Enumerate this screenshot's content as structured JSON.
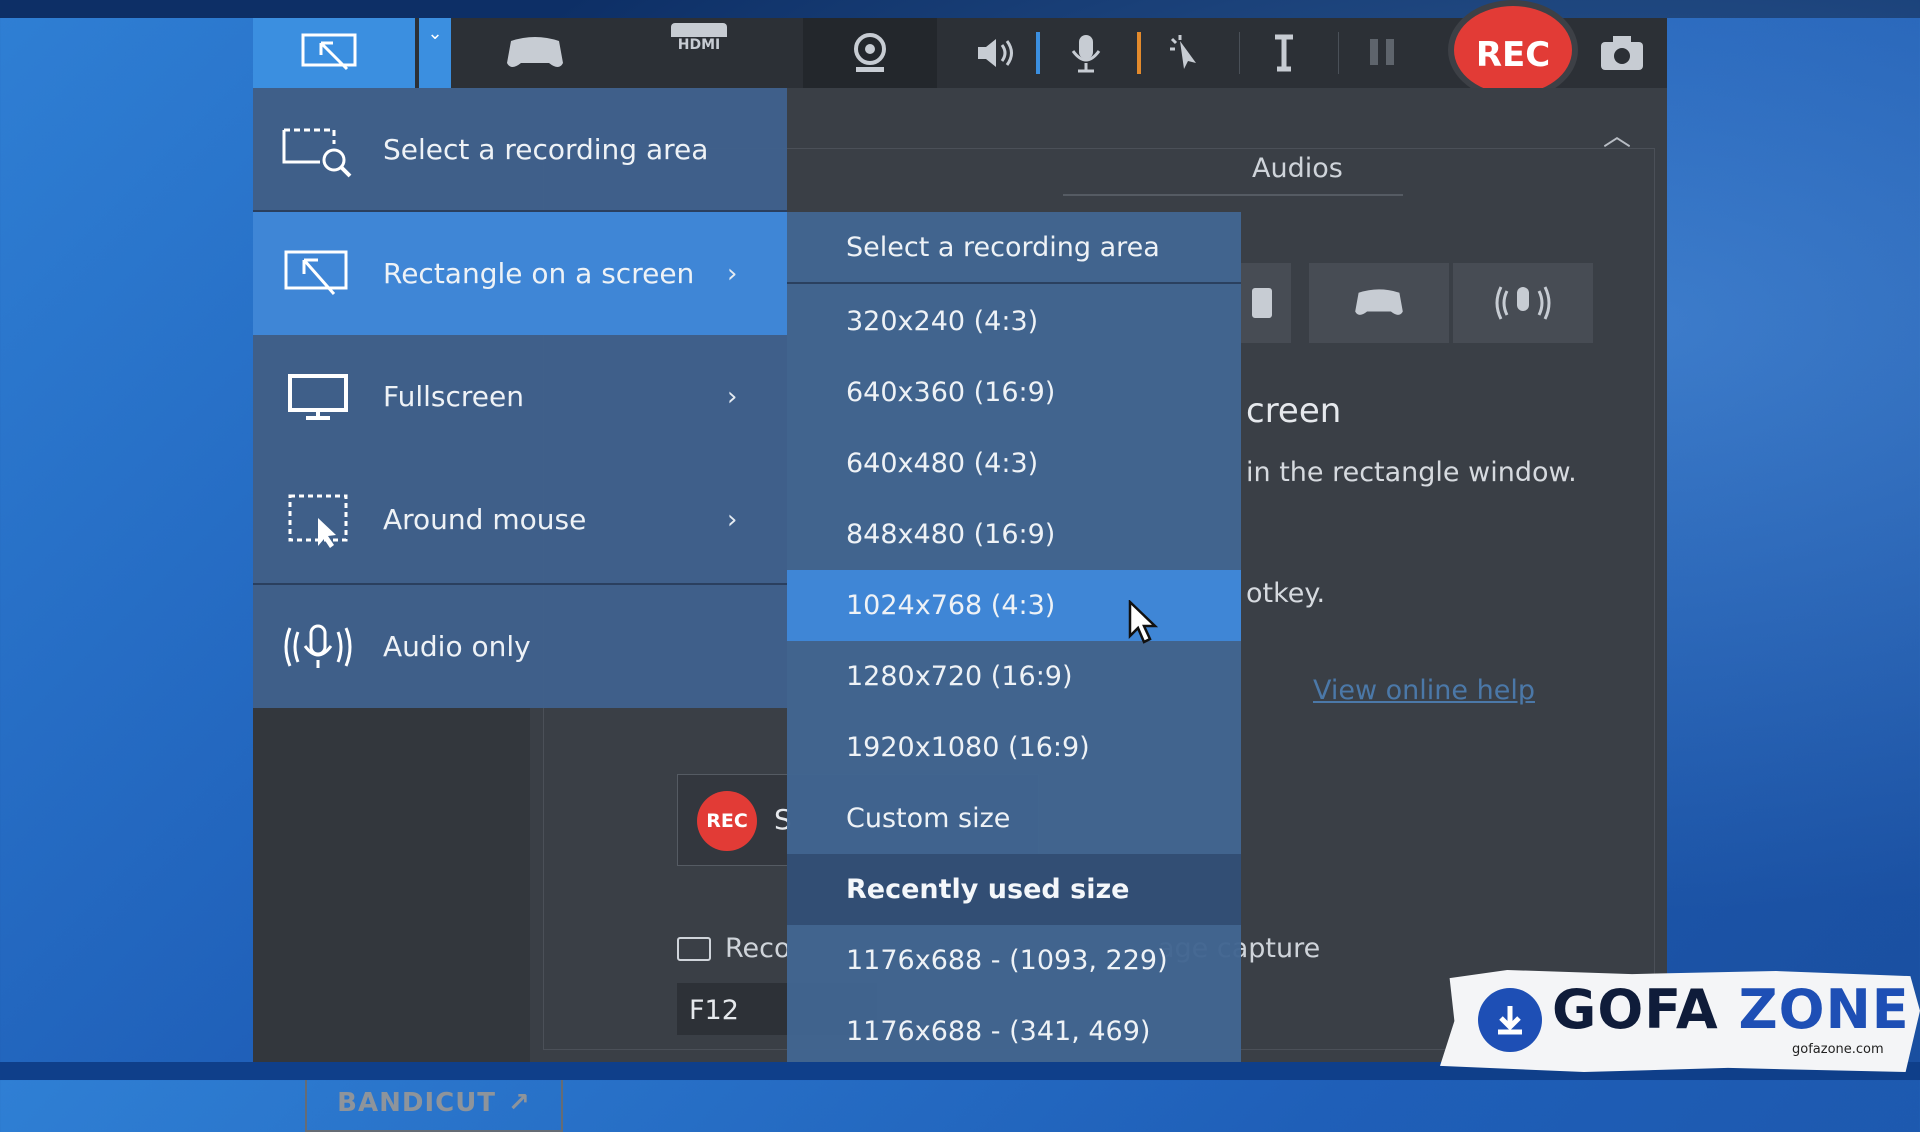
{
  "toolbar": {
    "rec_label": "REC",
    "hdmi_label": "HDMI"
  },
  "main_menu": {
    "items": [
      {
        "label": "Select a recording area",
        "icon": "area-search-icon",
        "submenu": false
      },
      {
        "label": "Rectangle on a screen",
        "icon": "rectangle-select-icon",
        "submenu": true,
        "highlighted": true
      },
      {
        "label": "Fullscreen",
        "icon": "monitor-icon",
        "submenu": true
      },
      {
        "label": "Around mouse",
        "icon": "around-mouse-icon",
        "submenu": true
      },
      {
        "label": "Audio only",
        "icon": "microphone-icon",
        "submenu": false
      }
    ],
    "arrow": "›"
  },
  "submenu": {
    "header": "Select a recording area",
    "sizes": [
      "320x240 (4:3)",
      "640x360 (16:9)",
      "640x480 (4:3)",
      "848x480 (16:9)",
      "1024x768 (4:3)",
      "1280x720 (16:9)",
      "1920x1080 (16:9)",
      "Custom size"
    ],
    "highlighted_index": 4,
    "recent_header": "Recently used size",
    "recent": [
      "1176x688 - (1093, 229)",
      "1176x688 - (341, 469)"
    ]
  },
  "background": {
    "tab_audios": "Audios",
    "content_title": "creen",
    "content_desc": "in the rectangle window.",
    "content_step": "otkey.",
    "help_link": "View online help",
    "rec_button_label": "REC",
    "rec_start_text": "S",
    "hotkey_label": "Reco",
    "hotkey_value": "F12",
    "image_capture_label": "age capture",
    "bandicut_label": "BANDICUT"
  },
  "watermark": {
    "brand_left": "GOFA",
    "brand_right": "ZONE",
    "site": "gofazone.com"
  },
  "colors": {
    "accent": "#3f86d6",
    "rec_red": "#e23b36",
    "menu_bg": "#3f618c"
  }
}
